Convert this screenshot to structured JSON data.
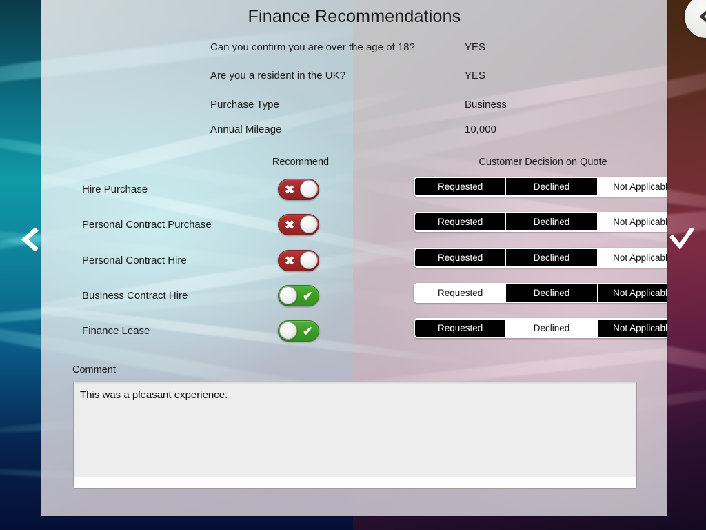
{
  "page_title": "Finance Recommendations",
  "summary": [
    {
      "label": "Can you confirm you are over the age of 18?",
      "value": "YES"
    },
    {
      "label": "Are you a resident in the UK?",
      "value": "YES"
    },
    {
      "label": "Purchase Type",
      "value": "Business"
    },
    {
      "label": "Annual Mileage",
      "value": "10,000"
    }
  ],
  "columns": {
    "recommend": "Recommend",
    "decision": "Customer Decision on Quote"
  },
  "decision_options": [
    "Requested",
    "Declined",
    "Not Applicable"
  ],
  "products": [
    {
      "label": "Hire Purchase",
      "recommend": false,
      "recommend_glyph": "✖",
      "decision": "Not Applicable"
    },
    {
      "label": "Personal Contract Purchase",
      "recommend": false,
      "recommend_glyph": "✖",
      "decision": "Not Applicable"
    },
    {
      "label": "Personal Contract Hire",
      "recommend": false,
      "recommend_glyph": "✖",
      "decision": "Not Applicable"
    },
    {
      "label": "Business Contract Hire",
      "recommend": true,
      "recommend_glyph": "✔",
      "decision": "Requested"
    },
    {
      "label": "Finance Lease",
      "recommend": true,
      "recommend_glyph": "✔",
      "decision": "Declined"
    }
  ],
  "comment": {
    "label": "Comment",
    "value": "This was a pleasant experience.",
    "placeholder": ""
  },
  "navigation": {
    "prev_label": "‹",
    "confirm_label": "✓",
    "back_label": "‹"
  },
  "colors": {
    "toggle_off": "#a22a2a",
    "toggle_on": "#3f9c27",
    "segment_selected_bg": "#ffffff",
    "segment_unselected_bg": "#000000",
    "comment_bg": "#ededed"
  }
}
